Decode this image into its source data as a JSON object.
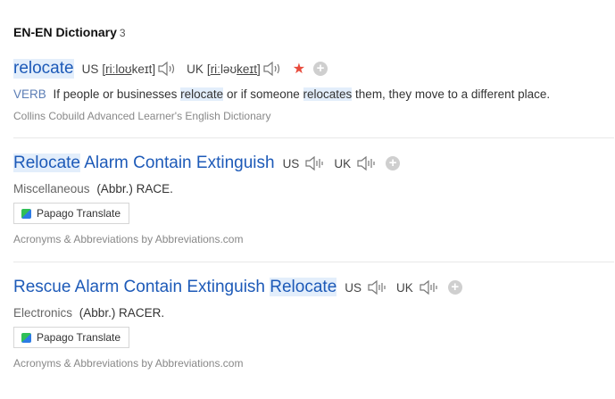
{
  "header": {
    "title": "EN-EN Dictionary",
    "count": "3"
  },
  "entry1": {
    "word": "relocate",
    "us_label": "US",
    "us_pron": {
      "open": "[",
      "syl1": "riː",
      "mid": "loʊ",
      "rest": "keɪt]"
    },
    "uk_label": "UK",
    "uk_pron": {
      "open": "[",
      "syl1": "riː",
      "mid": "ləʊ",
      "rest": "keɪt]"
    },
    "pos": "VERB",
    "def_part1": "If people or businesses",
    "def_hl1": "relocate",
    "def_part2": "or if someone",
    "def_hl2": "relocates",
    "def_part3": "them, they move to a different place.",
    "source": "Collins Cobuild Advanced Learner's English Dictionary"
  },
  "entry2": {
    "word_hl": "Relocate",
    "word_rest": "Alarm Contain Extinguish",
    "us_label": "US",
    "uk_label": "UK",
    "category": "Miscellaneous",
    "definition": "(Abbr.) RACE.",
    "papago_label": "Papago Translate",
    "source": "Acronyms & Abbreviations by Abbreviations.com"
  },
  "entry3": {
    "word_rest": "Rescue Alarm Contain Extinguish",
    "word_hl": "Relocate",
    "us_label": "US",
    "uk_label": "UK",
    "category": "Electronics",
    "definition": "(Abbr.) RACER.",
    "papago_label": "Papago Translate",
    "source": "Acronyms & Abbreviations by Abbreviations.com"
  },
  "colors": {
    "link": "#1d5ab8",
    "highlight": "#e3eefb",
    "star": "#e84b3c",
    "pos": "#5b7db5"
  },
  "icons": [
    "speaker-icon",
    "star-icon",
    "add-icon",
    "papago-icon"
  ]
}
